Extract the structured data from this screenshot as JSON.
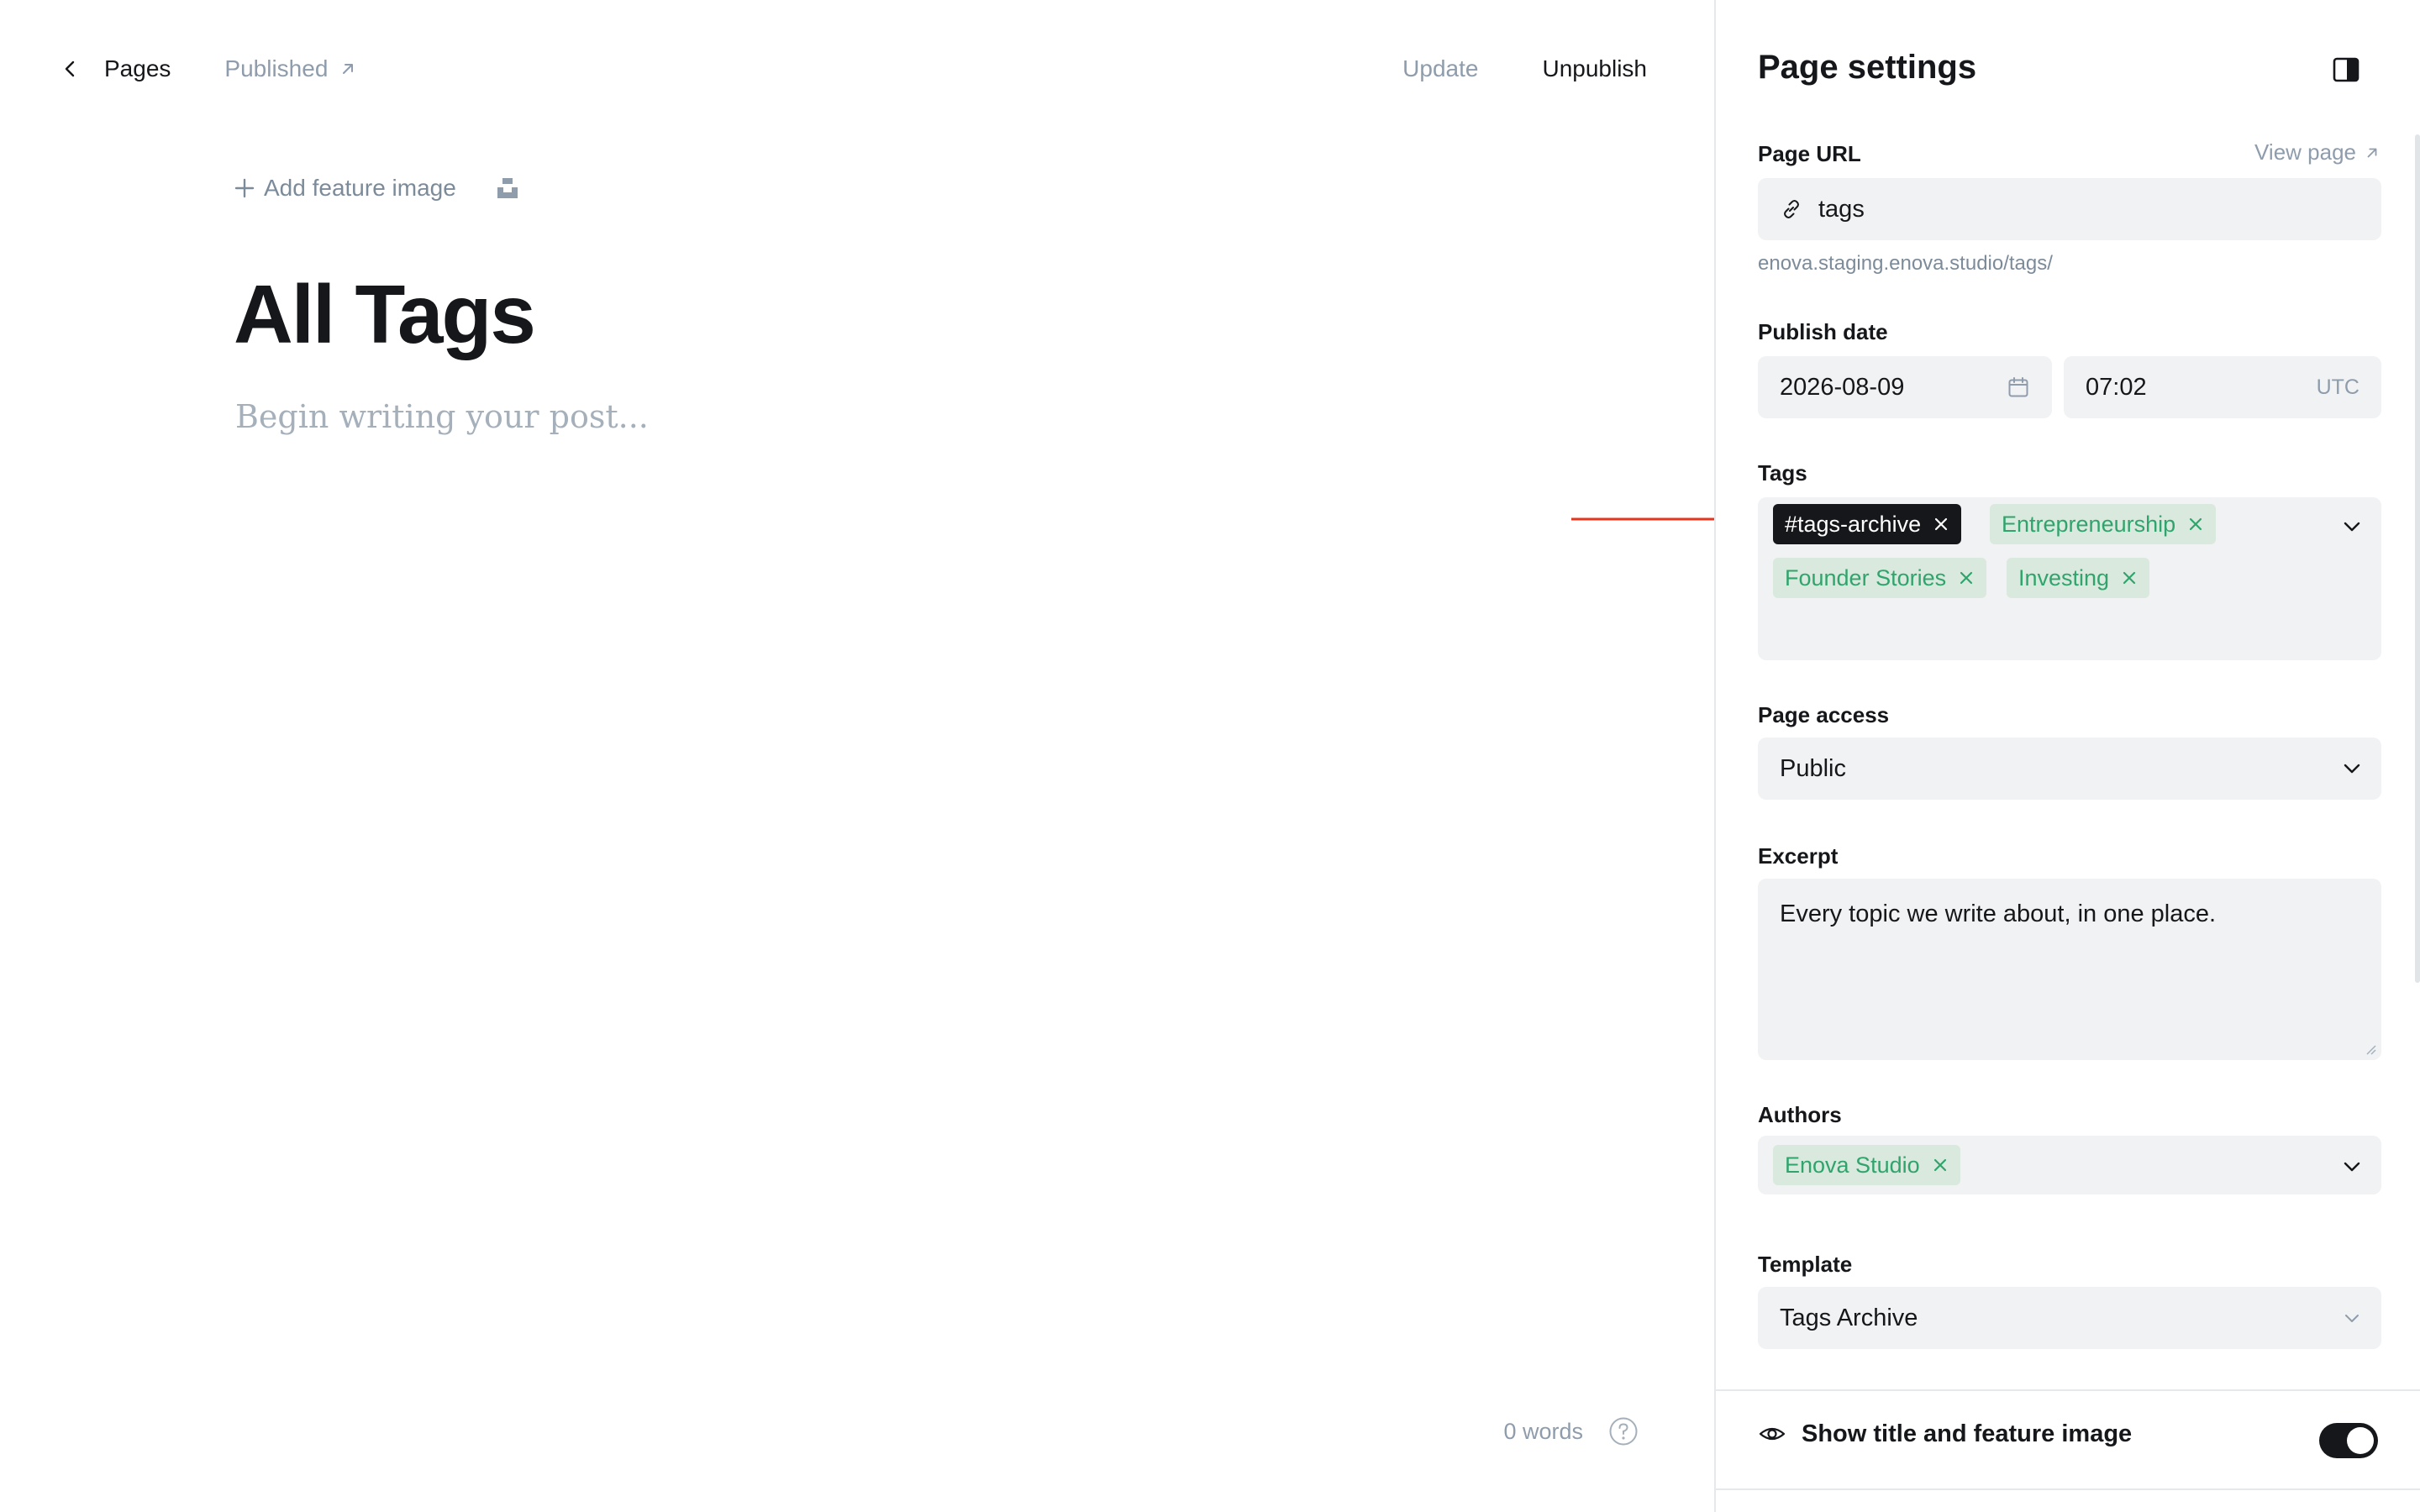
{
  "editor": {
    "back_label": "Pages",
    "status_label": "Published",
    "update_label": "Update",
    "unpublish_label": "Unpublish",
    "add_feature_label": "Add feature image",
    "title": "All Tags",
    "body_placeholder": "Begin writing your post...",
    "word_count": "0 words"
  },
  "settings": {
    "title": "Page settings",
    "url": {
      "label": "Page URL",
      "view_page_label": "View page",
      "value": "tags",
      "hint": "enova.staging.enova.studio/tags/"
    },
    "publish_date": {
      "label": "Publish date",
      "date": "2026-08-09",
      "time": "07:02",
      "timezone": "UTC"
    },
    "tags": {
      "label": "Tags",
      "items": [
        {
          "label": "#tags-archive",
          "internal": true
        },
        {
          "label": "Entrepreneurship",
          "internal": false
        },
        {
          "label": "Founder Stories",
          "internal": false
        },
        {
          "label": "Investing",
          "internal": false
        }
      ]
    },
    "access": {
      "label": "Page access",
      "value": "Public"
    },
    "excerpt": {
      "label": "Excerpt",
      "value": "Every topic we write about, in one place."
    },
    "authors": {
      "label": "Authors",
      "items": [
        {
          "label": "Enova Studio"
        }
      ]
    },
    "template": {
      "label": "Template",
      "value": "Tags Archive"
    },
    "show_title": {
      "label": "Show title and feature image",
      "enabled": true
    }
  },
  "colors": {
    "annotation_arrow": "#e8341c",
    "chip_green_bg": "#d9e9dd",
    "chip_green_text": "#30a46c",
    "chip_dark_bg": "#15171a",
    "field_bg": "#f1f2f3"
  }
}
